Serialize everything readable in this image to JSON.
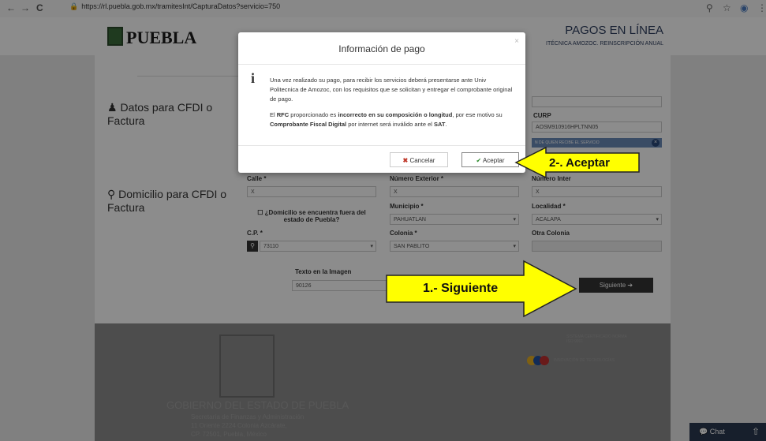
{
  "browser": {
    "url": "https://rl.puebla.gob.mx/tramitesInt/CapturaDatos?servicio=750",
    "back": "←",
    "forward": "→",
    "reload": "C"
  },
  "header": {
    "logo_text": "PUEBLA",
    "title": "PAGOS EN LÍNEA",
    "subtitle": "ITÉCNICA AMOZOC. REINSCRIPCIÓN ANUAL"
  },
  "sections": {
    "cfdi_title_1": "Datos para CFDI o",
    "cfdi_title_2": "Factura",
    "domicilio_title_1": "Domicilio para CFDI o",
    "domicilio_title_2": "Factura",
    "domicilio_checkbox": "¿Domicilio se encuentra fuera del estado de Puebla?"
  },
  "fields": {
    "curp_label": "CURP",
    "curp_value": "AOSM910916HPLTNN05",
    "blue_band": "N DE QUIEN RECIBE EL SERVICIO",
    "calle_label": "Calle *",
    "calle_value": "X",
    "numext_label": "Número Exterior *",
    "numext_value": "X",
    "numint_label": "Número Inter",
    "numint_value": "X",
    "municipio_label": "Municipio *",
    "municipio_value": "PAHUATLAN",
    "localidad_label": "Localidad *",
    "localidad_value": "ACALAPA",
    "cp_label": "C.P. *",
    "cp_value": "73110",
    "colonia_label": "Colonia *",
    "colonia_value": "SAN PABLITO",
    "otra_colonia_label": "Otra Colonia",
    "captcha_label": "Texto en la Imagen",
    "captcha_value": "90126",
    "siguiente_label": "Siguiente ➔"
  },
  "footer": {
    "gov_title": "GOBIERNO DEL ESTADO DE PUEBLA",
    "line1": "Secretaría de Finanzas y Administración",
    "line2": "11 Oriente 2224 Colonia Azcárate,",
    "line3": "CP. 72501, Puebla, México",
    "right_text": "SISTEMA CERTIFICADO NORMA ISO 9001",
    "right_text2": "INNOVACIÓN DE TECNOLOGÍAS"
  },
  "chat": {
    "label": "Chat"
  },
  "modal": {
    "title": "Información de pago",
    "close": "×",
    "p1": "Una vez realizado su pago, para recibir los servicios deberá presentarse ante Univ Politecnica de Amozoc, con los requisitos que se solicitan y entregar el comprobante original de pago.",
    "p2_a": "El ",
    "p2_b": "RFC",
    "p2_c": " proporcionado es ",
    "p2_d": "incorrecto en su composición o longitud",
    "p2_e": ", por ese motivo su ",
    "p2_f": "Comprobante Fiscal Digital",
    "p2_g": " por internet será inválido ante el ",
    "p2_h": "SAT",
    "p2_i": ".",
    "cancel_label": "Cancelar",
    "accept_label": "Aceptar"
  },
  "callouts": {
    "accept": "2-. Aceptar",
    "next": "1.- Siguiente"
  },
  "colors": {
    "callout_yellow": "#ffff00",
    "header_navy": "#2f3f5f",
    "footer_gray": "#8c8c8c",
    "chat_bg": "#2b3950"
  }
}
